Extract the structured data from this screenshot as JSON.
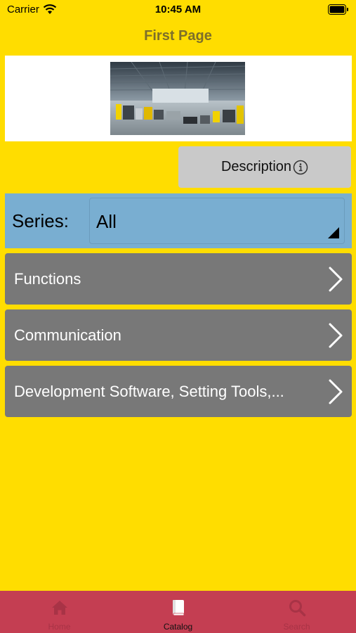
{
  "status_bar": {
    "carrier": "Carrier",
    "time": "10:45 AM"
  },
  "nav": {
    "title": "First Page"
  },
  "banner": {
    "image": "factory-hall-photo"
  },
  "description_button": {
    "label": "Description",
    "icon": "info-icon"
  },
  "series": {
    "label": "Series:",
    "value": "All"
  },
  "rows": [
    {
      "label": "Functions"
    },
    {
      "label": "Communication"
    },
    {
      "label": "Development Software, Setting Tools,..."
    }
  ],
  "tabs": [
    {
      "label": "Home",
      "icon": "home-icon",
      "active": false
    },
    {
      "label": "Catalog",
      "icon": "book-icon",
      "active": true
    },
    {
      "label": "Search",
      "icon": "search-icon",
      "active": false
    }
  ],
  "colors": {
    "background": "#FFDD00",
    "series_bg": "#79AED1",
    "row_bg": "#787878",
    "tab_bar_bg": "#C43E52",
    "description_bg": "#C9C9C9"
  }
}
